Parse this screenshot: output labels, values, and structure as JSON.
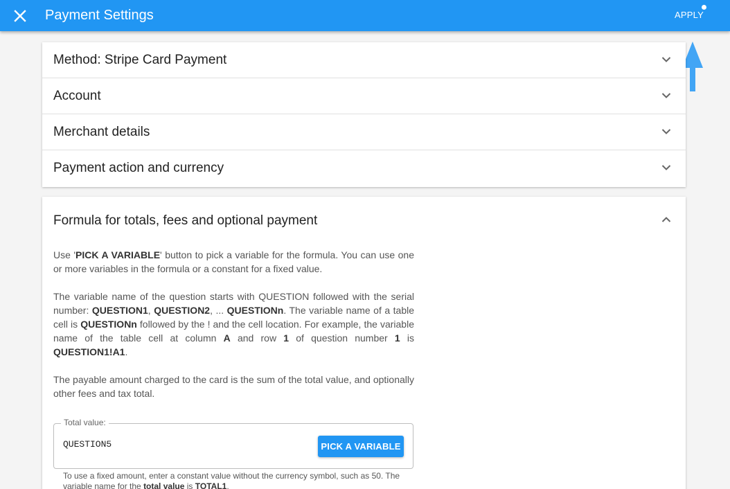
{
  "app_bar": {
    "title": "Payment Settings",
    "apply_label": "APPLY",
    "close_icon": "close-icon",
    "color": "#2196f3"
  },
  "panels": [
    {
      "title": "Method: Stripe Card Payment"
    },
    {
      "title": "Account"
    },
    {
      "title": "Merchant details"
    },
    {
      "title": "Payment action and currency"
    }
  ],
  "formula_panel": {
    "title": "Formula for totals, fees and optional payment",
    "p1": {
      "a": "Use '",
      "b": "PICK A VARIABLE",
      "c": "' button to pick a variable for the formula. You can use one or more variables in the formula or a constant for a fixed value."
    },
    "p2": {
      "a": "The variable name of the question starts with QUESTION followed with the serial number: ",
      "b": "QUESTION1",
      "c": ", ",
      "d": "QUESTION2",
      "e": ", ... ",
      "f": "QUESTIONn",
      "g": ". The variable name of a table cell is ",
      "h": "QUESTIONn",
      "i": " followed by the ! and the cell location. For example, the variable name of the table cell at column ",
      "j": "A",
      "k": " and row ",
      "l": "1",
      "m": " of question number ",
      "n": "1",
      "o": " is ",
      "p": "QUESTION1!A1",
      "q": "."
    },
    "p3": "The payable amount charged to the card is the sum of the total value, and optionally other fees and tax total.",
    "total_field": {
      "label": "Total value:",
      "value": "QUESTION5",
      "button": "PICK A VARIABLE"
    },
    "help": {
      "a": "To use a fixed amount, enter a constant value without the currency symbol, such as 50. The variable name for the ",
      "b": "total value",
      "c": " is ",
      "d": "TOTAL1",
      "e": "."
    }
  }
}
